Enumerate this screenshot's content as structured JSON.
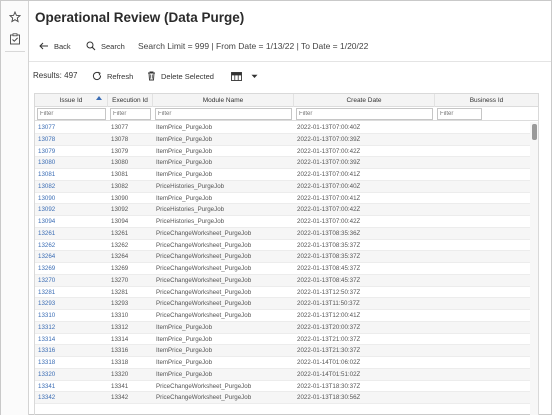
{
  "page": {
    "title": "Operational Review (Data Purge)"
  },
  "toolbar": {
    "back_label": "Back",
    "search_label": "Search",
    "criteria": "Search Limit = 999 | From Date = 1/13/22 | To Date = 1/20/22"
  },
  "results_bar": {
    "results_label": "Results: 497",
    "refresh_label": "Refresh",
    "delete_label": "Delete Selected",
    "view_icon": "grid-view-icon"
  },
  "grid": {
    "columns": [
      "Issue Id",
      "Execution Id",
      "Module Name",
      "Create Date",
      "Business Id"
    ],
    "sorted_column": "Issue Id",
    "filter_placeholder": "Filter",
    "rows": [
      [
        "13077",
        "13077",
        "ItemPrice_PurgeJob",
        "2022-01-13T07:00:40Z",
        ""
      ],
      [
        "13078",
        "13078",
        "ItemPrice_PurgeJob",
        "2022-01-13T07:00:39Z",
        ""
      ],
      [
        "13079",
        "13079",
        "ItemPrice_PurgeJob",
        "2022-01-13T07:00:42Z",
        ""
      ],
      [
        "13080",
        "13080",
        "ItemPrice_PurgeJob",
        "2022-01-13T07:00:39Z",
        ""
      ],
      [
        "13081",
        "13081",
        "ItemPrice_PurgeJob",
        "2022-01-13T07:00:41Z",
        ""
      ],
      [
        "13082",
        "13082",
        "PriceHistories_PurgeJob",
        "2022-01-13T07:00:40Z",
        ""
      ],
      [
        "13090",
        "13090",
        "ItemPrice_PurgeJob",
        "2022-01-13T07:00:41Z",
        ""
      ],
      [
        "13092",
        "13092",
        "PriceHistories_PurgeJob",
        "2022-01-13T07:00:42Z",
        ""
      ],
      [
        "13094",
        "13094",
        "PriceHistories_PurgeJob",
        "2022-01-13T07:00:42Z",
        ""
      ],
      [
        "13261",
        "13261",
        "PriceChangeWorksheet_PurgeJob",
        "2022-01-13T08:35:36Z",
        ""
      ],
      [
        "13262",
        "13262",
        "PriceChangeWorksheet_PurgeJob",
        "2022-01-13T08:35:37Z",
        ""
      ],
      [
        "13264",
        "13264",
        "PriceChangeWorksheet_PurgeJob",
        "2022-01-13T08:35:37Z",
        ""
      ],
      [
        "13269",
        "13269",
        "PriceChangeWorksheet_PurgeJob",
        "2022-01-13T08:45:37Z",
        ""
      ],
      [
        "13270",
        "13270",
        "PriceChangeWorksheet_PurgeJob",
        "2022-01-13T08:45:37Z",
        ""
      ],
      [
        "13281",
        "13281",
        "PriceChangeWorksheet_PurgeJob",
        "2022-01-13T12:50:37Z",
        ""
      ],
      [
        "13293",
        "13293",
        "PriceChangeWorksheet_PurgeJob",
        "2022-01-13T11:50:37Z",
        ""
      ],
      [
        "13310",
        "13310",
        "PriceChangeWorksheet_PurgeJob",
        "2022-01-13T12:00:41Z",
        ""
      ],
      [
        "13312",
        "13312",
        "ItemPrice_PurgeJob",
        "2022-01-13T20:00:37Z",
        ""
      ],
      [
        "13314",
        "13314",
        "ItemPrice_PurgeJob",
        "2022-01-13T21:00:37Z",
        ""
      ],
      [
        "13316",
        "13316",
        "ItemPrice_PurgeJob",
        "2022-01-13T21:30:37Z",
        ""
      ],
      [
        "13318",
        "13318",
        "ItemPrice_PurgeJob",
        "2022-01-14T01:06:02Z",
        ""
      ],
      [
        "13320",
        "13320",
        "ItemPrice_PurgeJob",
        "2022-01-14T01:51:02Z",
        ""
      ],
      [
        "13341",
        "13341",
        "PriceChangeWorksheet_PurgeJob",
        "2022-01-13T18:30:37Z",
        ""
      ],
      [
        "13342",
        "13342",
        "PriceChangeWorksheet_PurgeJob",
        "2022-01-13T18:30:56Z",
        ""
      ]
    ]
  },
  "colors": {
    "link": "#3b6db5",
    "header_bg": "#f4f4f4",
    "row_alt": "#f6f6f6"
  }
}
